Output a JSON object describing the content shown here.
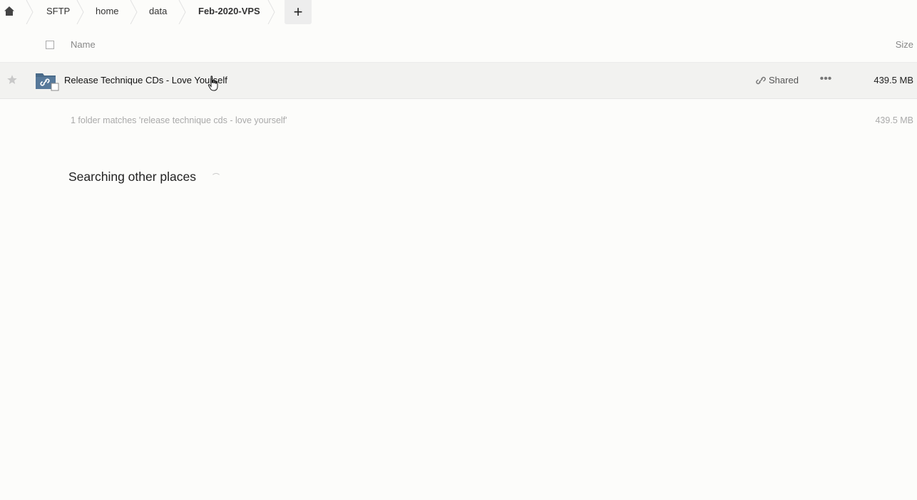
{
  "breadcrumb": {
    "home_icon": "home-icon",
    "items": [
      "SFTP",
      "home",
      "data",
      "Feb-2020-VPS"
    ],
    "add_icon": "plus-icon",
    "add_label": "+"
  },
  "table": {
    "header": {
      "name": "Name",
      "size": "Size"
    },
    "rows": [
      {
        "name": "Release Technique CDs - Love Yourself",
        "shared_label": "Shared",
        "size": "439.5 MB",
        "more_label": "•••",
        "icon": "shared-folder-icon"
      }
    ],
    "summary": {
      "text": "1 folder matches 'release technique cds - love yourself'",
      "size": "439.5 MB"
    }
  },
  "search_other": {
    "label": "Searching other places"
  },
  "colors": {
    "background": "#fcfcfa",
    "row_hover": "#f2f2f0",
    "folder_icon": "#4a6b8a"
  }
}
